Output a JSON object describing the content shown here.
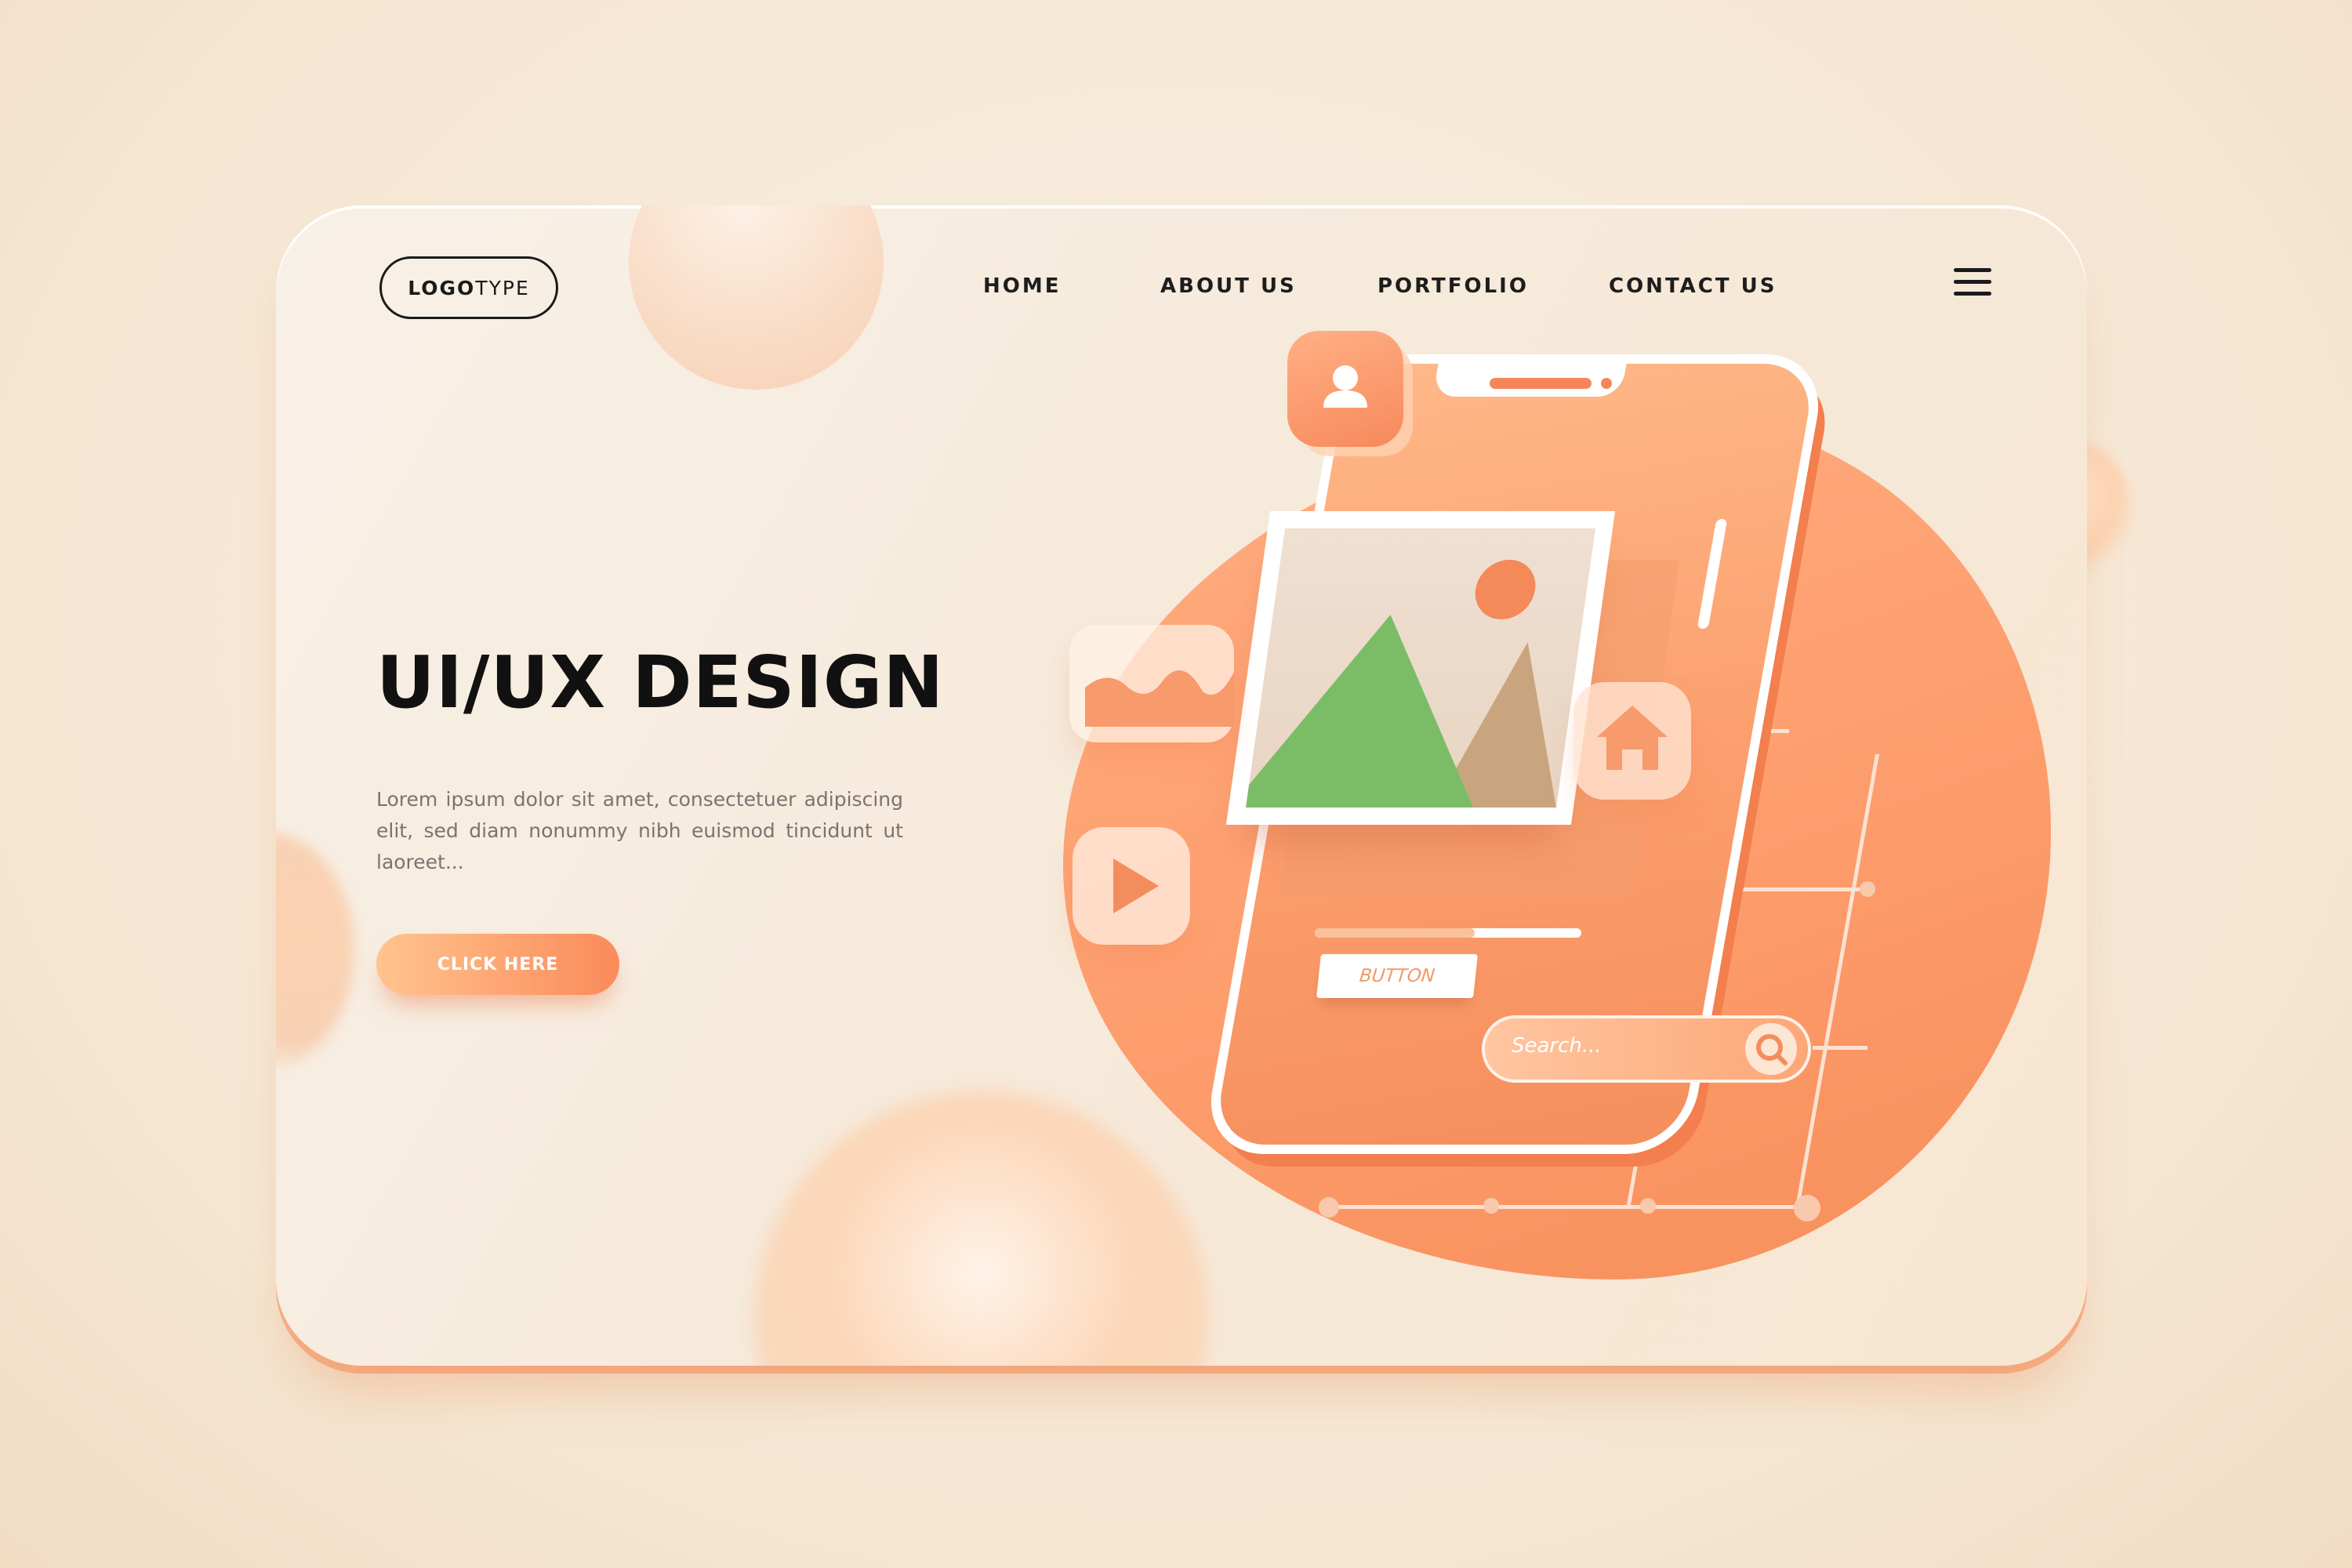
{
  "logo": {
    "bold": "LOGO",
    "light": "TYPE"
  },
  "nav": {
    "items": [
      {
        "label": "HOME"
      },
      {
        "label": "ABOUT US"
      },
      {
        "label": "PORTFOLIO"
      },
      {
        "label": "CONTACT US"
      }
    ],
    "menu_icon": "hamburger-icon"
  },
  "hero": {
    "title": "UI/UX DESIGN",
    "description": "Lorem ipsum dolor sit amet, consectetuer adipiscing elit, sed diam nonummy nibh euismod tincidunt ut laoreet...",
    "cta_label": "CLICK HERE"
  },
  "illustration": {
    "phone_button_label": "BUTTON",
    "search_placeholder": "Search...",
    "icons": [
      "user-icon",
      "image-icon",
      "chart-icon",
      "play-icon",
      "home-icon",
      "search-icon"
    ]
  },
  "colors": {
    "accent": "#fb9a68",
    "accent_light": "#ffc48e",
    "text_dark": "#111111",
    "text_muted": "#7a7470",
    "background": "#f6e9d9"
  }
}
